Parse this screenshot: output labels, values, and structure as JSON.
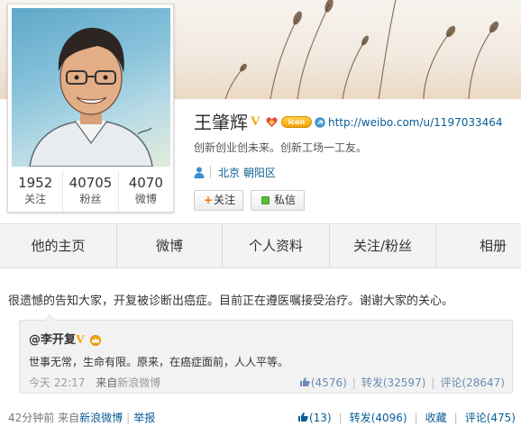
{
  "profile": {
    "name": "王肇辉",
    "member_badge": "icon",
    "url": "http://weibo.com/u/1197033464",
    "bio": "创新创业创未来。创新工场一工友。",
    "location": "北京 朝阳区",
    "stats": [
      {
        "value": "1952",
        "label": "关注"
      },
      {
        "value": "40705",
        "label": "粉丝"
      },
      {
        "value": "4070",
        "label": "微博"
      }
    ],
    "follow_button": "关注",
    "message_button": "私信"
  },
  "tabs": [
    "他的主页",
    "微博",
    "个人资料",
    "关注/粉丝",
    "相册"
  ],
  "post": {
    "text": "很遗憾的告知大家，开复被诊断出癌症。目前正在遵医嘱接受治疗。谢谢大家的关心。",
    "repost": {
      "author": "@李开复",
      "text": "世事无常，生命有限。原来，在癌症面前，人人平等。",
      "time": "今天 22:17",
      "from_label": "来自",
      "source": "新浪微博",
      "likes": "(4576)",
      "repost_label": "转发",
      "repost_count": "(32597)",
      "comment_label": "评论",
      "comment_count": "(28647)"
    },
    "time": "42分钟前",
    "from_label": "来自",
    "source": "新浪微博",
    "report": "举报",
    "likes": "(13)",
    "repost_label": "转发",
    "repost_count": "(4096)",
    "favorite_label": "收藏",
    "comment_label": "评论",
    "comment_count": "(475)"
  },
  "colors": {
    "link": "#0a5c93",
    "verified": "#f3a400",
    "tab_bg": "#f3f3f3",
    "repost_bg": "#f2f2f2"
  },
  "icons": [
    "verified-v-icon",
    "heart-badge-icon",
    "link-icon",
    "person-icon",
    "plus-icon",
    "message-icon",
    "crown-icon",
    "thumb-up-icon"
  ]
}
